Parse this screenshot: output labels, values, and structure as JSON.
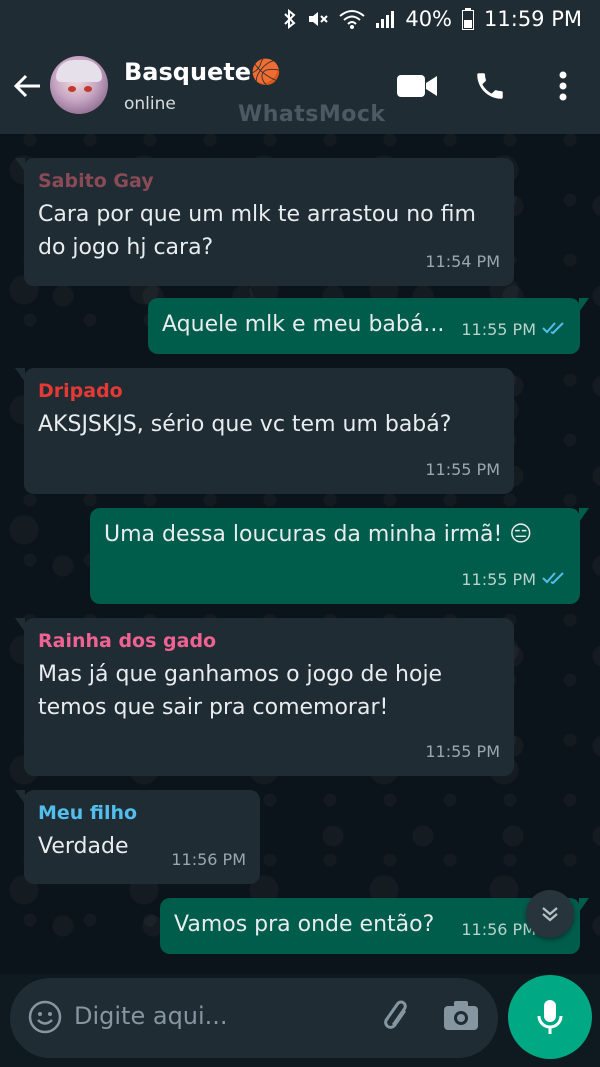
{
  "status_bar": {
    "battery": "40%",
    "time": "11:59 PM"
  },
  "header": {
    "contact_name": "Basquete🏀",
    "status": "online",
    "watermark": "WhatsMock"
  },
  "messages": [
    {
      "direction": "in",
      "sender": "Sabito Gay",
      "sender_color": "#8a4b57",
      "text": "Cara por que um mlk te arrastou no fim do jogo hj cara?",
      "time": "11:54 PM"
    },
    {
      "direction": "out",
      "text": "Aquele mlk e meu babá...",
      "time": "11:55 PM",
      "read": true
    },
    {
      "direction": "in",
      "sender": "Dripado",
      "sender_color": "#e53935",
      "text": "AKSJSKJS, sério que vc tem um babá?",
      "time": "11:55 PM"
    },
    {
      "direction": "out",
      "text": "Uma dessa loucuras da minha irmã! 😑",
      "time": "11:55 PM",
      "read": true
    },
    {
      "direction": "in",
      "sender": "Rainha dos gado",
      "sender_color": "#f06292",
      "text": "Mas já que ganhamos o jogo de hoje temos que sair pra comemorar!",
      "time": "11:55 PM"
    },
    {
      "direction": "in",
      "sender": "Meu filho",
      "sender_color": "#53bdeb",
      "text": "Verdade",
      "time": "11:56 PM"
    },
    {
      "direction": "out",
      "text": "Vamos pra onde então?",
      "time": "11:56 PM",
      "read": true
    }
  ],
  "composer": {
    "placeholder": "Digite aqui..."
  },
  "colors": {
    "incoming_bubble": "#1f2c34",
    "outgoing_bubble": "#005c4b",
    "accent": "#00a884",
    "read_ticks": "#53bdeb"
  },
  "icons": [
    "back-arrow-icon",
    "video-call-icon",
    "phone-icon",
    "more-options-icon",
    "emoji-icon",
    "attach-icon",
    "camera-icon",
    "mic-icon",
    "scroll-down-icon",
    "double-check-icon"
  ]
}
